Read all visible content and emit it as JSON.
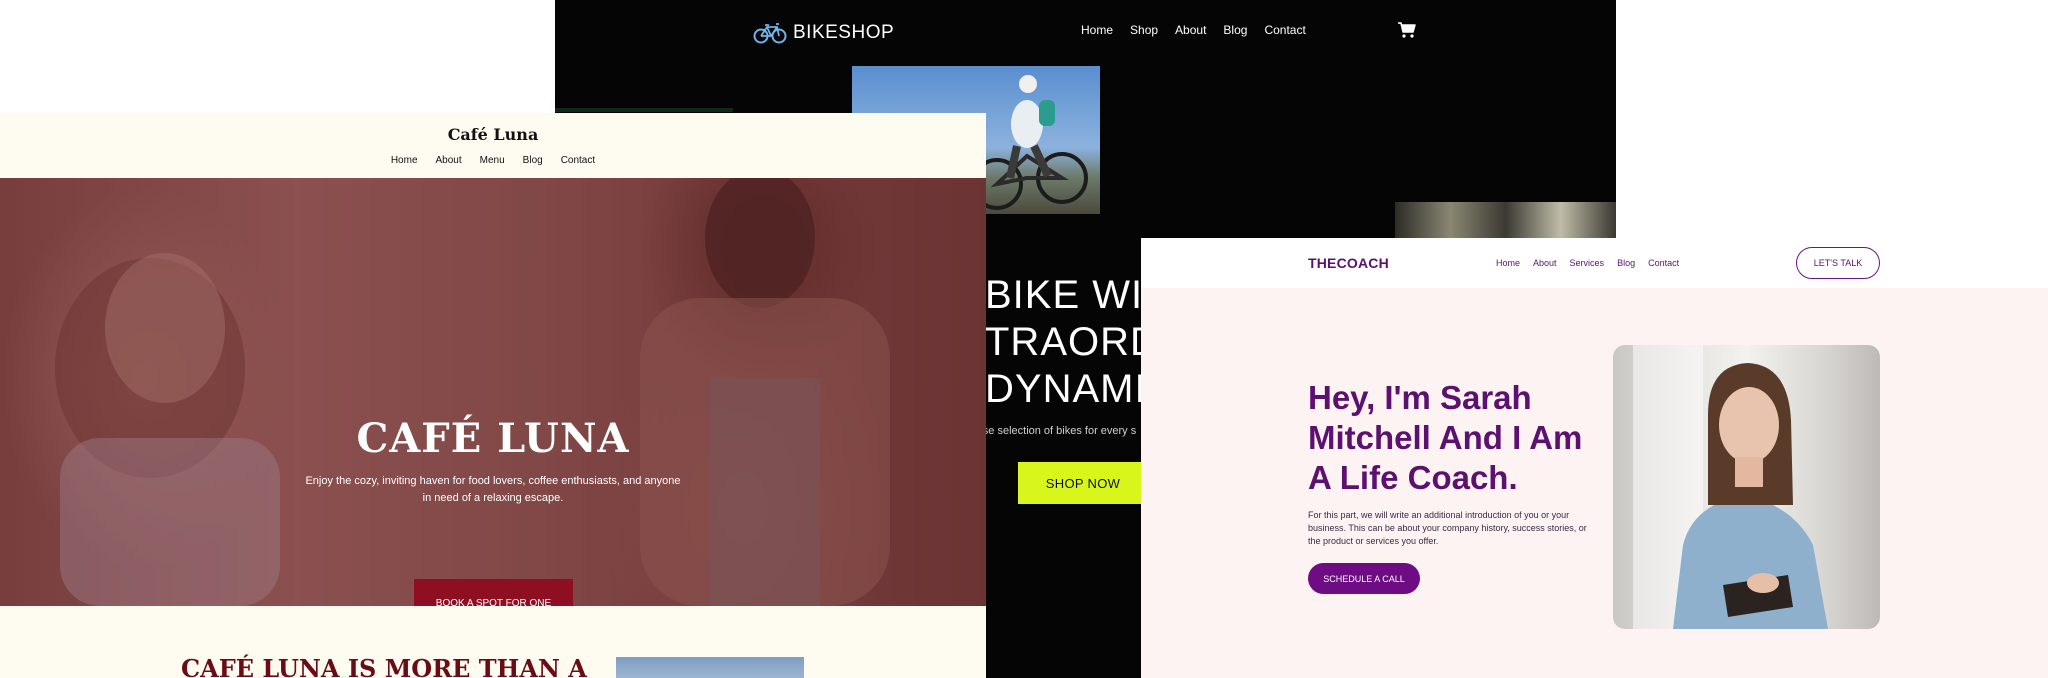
{
  "bikeshop": {
    "logo": "BIKESHOP",
    "nav": [
      "Home",
      "Shop",
      "About",
      "Blog",
      "Contact"
    ],
    "hero_lines": [
      "BIKE WIT",
      "TRAORDI",
      "DYNAMIC"
    ],
    "subtitle": "erse selection of bikes for every s",
    "cta": "SHOP NOW",
    "accent": "#d8f51c"
  },
  "cafe": {
    "logo": "Café Luna",
    "nav": [
      "Home",
      "About",
      "Menu",
      "Blog",
      "Contact"
    ],
    "hero_title": "CAFÉ LUNA",
    "hero_desc": "Enjoy the cozy, inviting haven for food lovers, coffee enthusiasts, and anyone in need of a relaxing escape.",
    "cta": "BOOK A SPOT FOR ONE",
    "section_heading": "CAFÉ LUNA IS MORE THAN A",
    "accent": "#8e0e22"
  },
  "coach": {
    "logo": "THECOACH",
    "nav": [
      "Home",
      "About",
      "Services",
      "Blog",
      "Contact"
    ],
    "header_cta": "LET'S TALK",
    "headline": "Hey, I'm Sarah Mitchell And I Am A Life Coach.",
    "intro": "For this part, we will write an additional introduction of you or your business. This can be about your company history, success stories, or the product or services you offer.",
    "cta": "SCHEDULE A CALL",
    "accent": "#6e0c84"
  }
}
